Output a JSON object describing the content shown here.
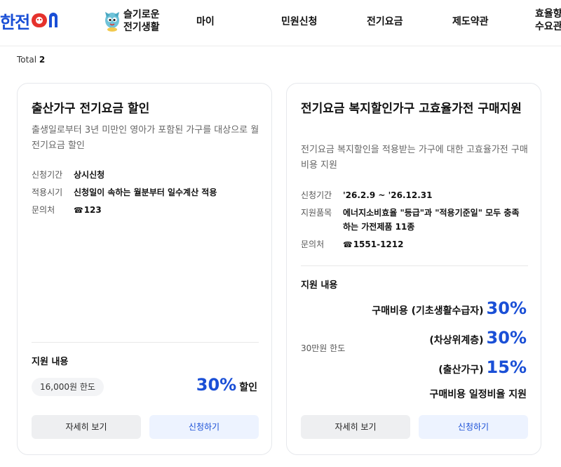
{
  "header": {
    "logo_text": "한전",
    "logo_on": "ON",
    "mascot_line1": "슬기로운",
    "mascot_line2": "전기생활",
    "nav": [
      "마이",
      "민원신청",
      "전기요금",
      "제도약관"
    ],
    "nav_last_line1": "효율향",
    "nav_last_line2": "수요관"
  },
  "total": {
    "label": "Total",
    "count": "2"
  },
  "cards": [
    {
      "title": "출산가구 전기요금 할인",
      "desc": "출생일로부터 3년 미만인 영아가 포함된 가구를 대상으로 월 전기요금 할인",
      "info": [
        {
          "label": "신청기간",
          "value": "상시신청"
        },
        {
          "label": "적용시기",
          "value": "신청일이 속하는 월분부터 일수계산 적용"
        },
        {
          "label": "문의처",
          "value": "123"
        }
      ],
      "support_title": "지원 내용",
      "limit": "16,000원 한도",
      "percent": "30%",
      "percent_suffix": "할인",
      "btn_detail": "자세히 보기",
      "btn_apply": "신청하기"
    },
    {
      "title": "전기요금 복지할인가구 고효율가전 구매지원",
      "desc": "전기요금 복지할인을 적용받는 가구에 대한 고효율가전 구매비용 지원",
      "info": [
        {
          "label": "신청기간",
          "value": "'26.2.9 ~ '26.12.31"
        },
        {
          "label": "지원품목",
          "value": "에너지소비효율 \"등급\"과 \"적용기준일\" 모두 충족하는 가전제품 11종"
        },
        {
          "label": "문의처",
          "value": "1551-1212"
        }
      ],
      "support_title": "지원 내용",
      "limit": "30만원 한도",
      "support_lines": [
        {
          "label": "구매비용 (기초생활수급자)",
          "percent": "30%"
        },
        {
          "label": "(차상위계층)",
          "percent": "30%"
        },
        {
          "label": "(출산가구)",
          "percent": "15%"
        }
      ],
      "support_foot": "구매비용 일정비율 지원",
      "btn_detail": "자세히 보기",
      "btn_apply": "신청하기"
    }
  ],
  "colors": {
    "accent": "#1a4fd6",
    "apply_bg": "#edf3ff",
    "detail_bg": "#eeeff1"
  }
}
